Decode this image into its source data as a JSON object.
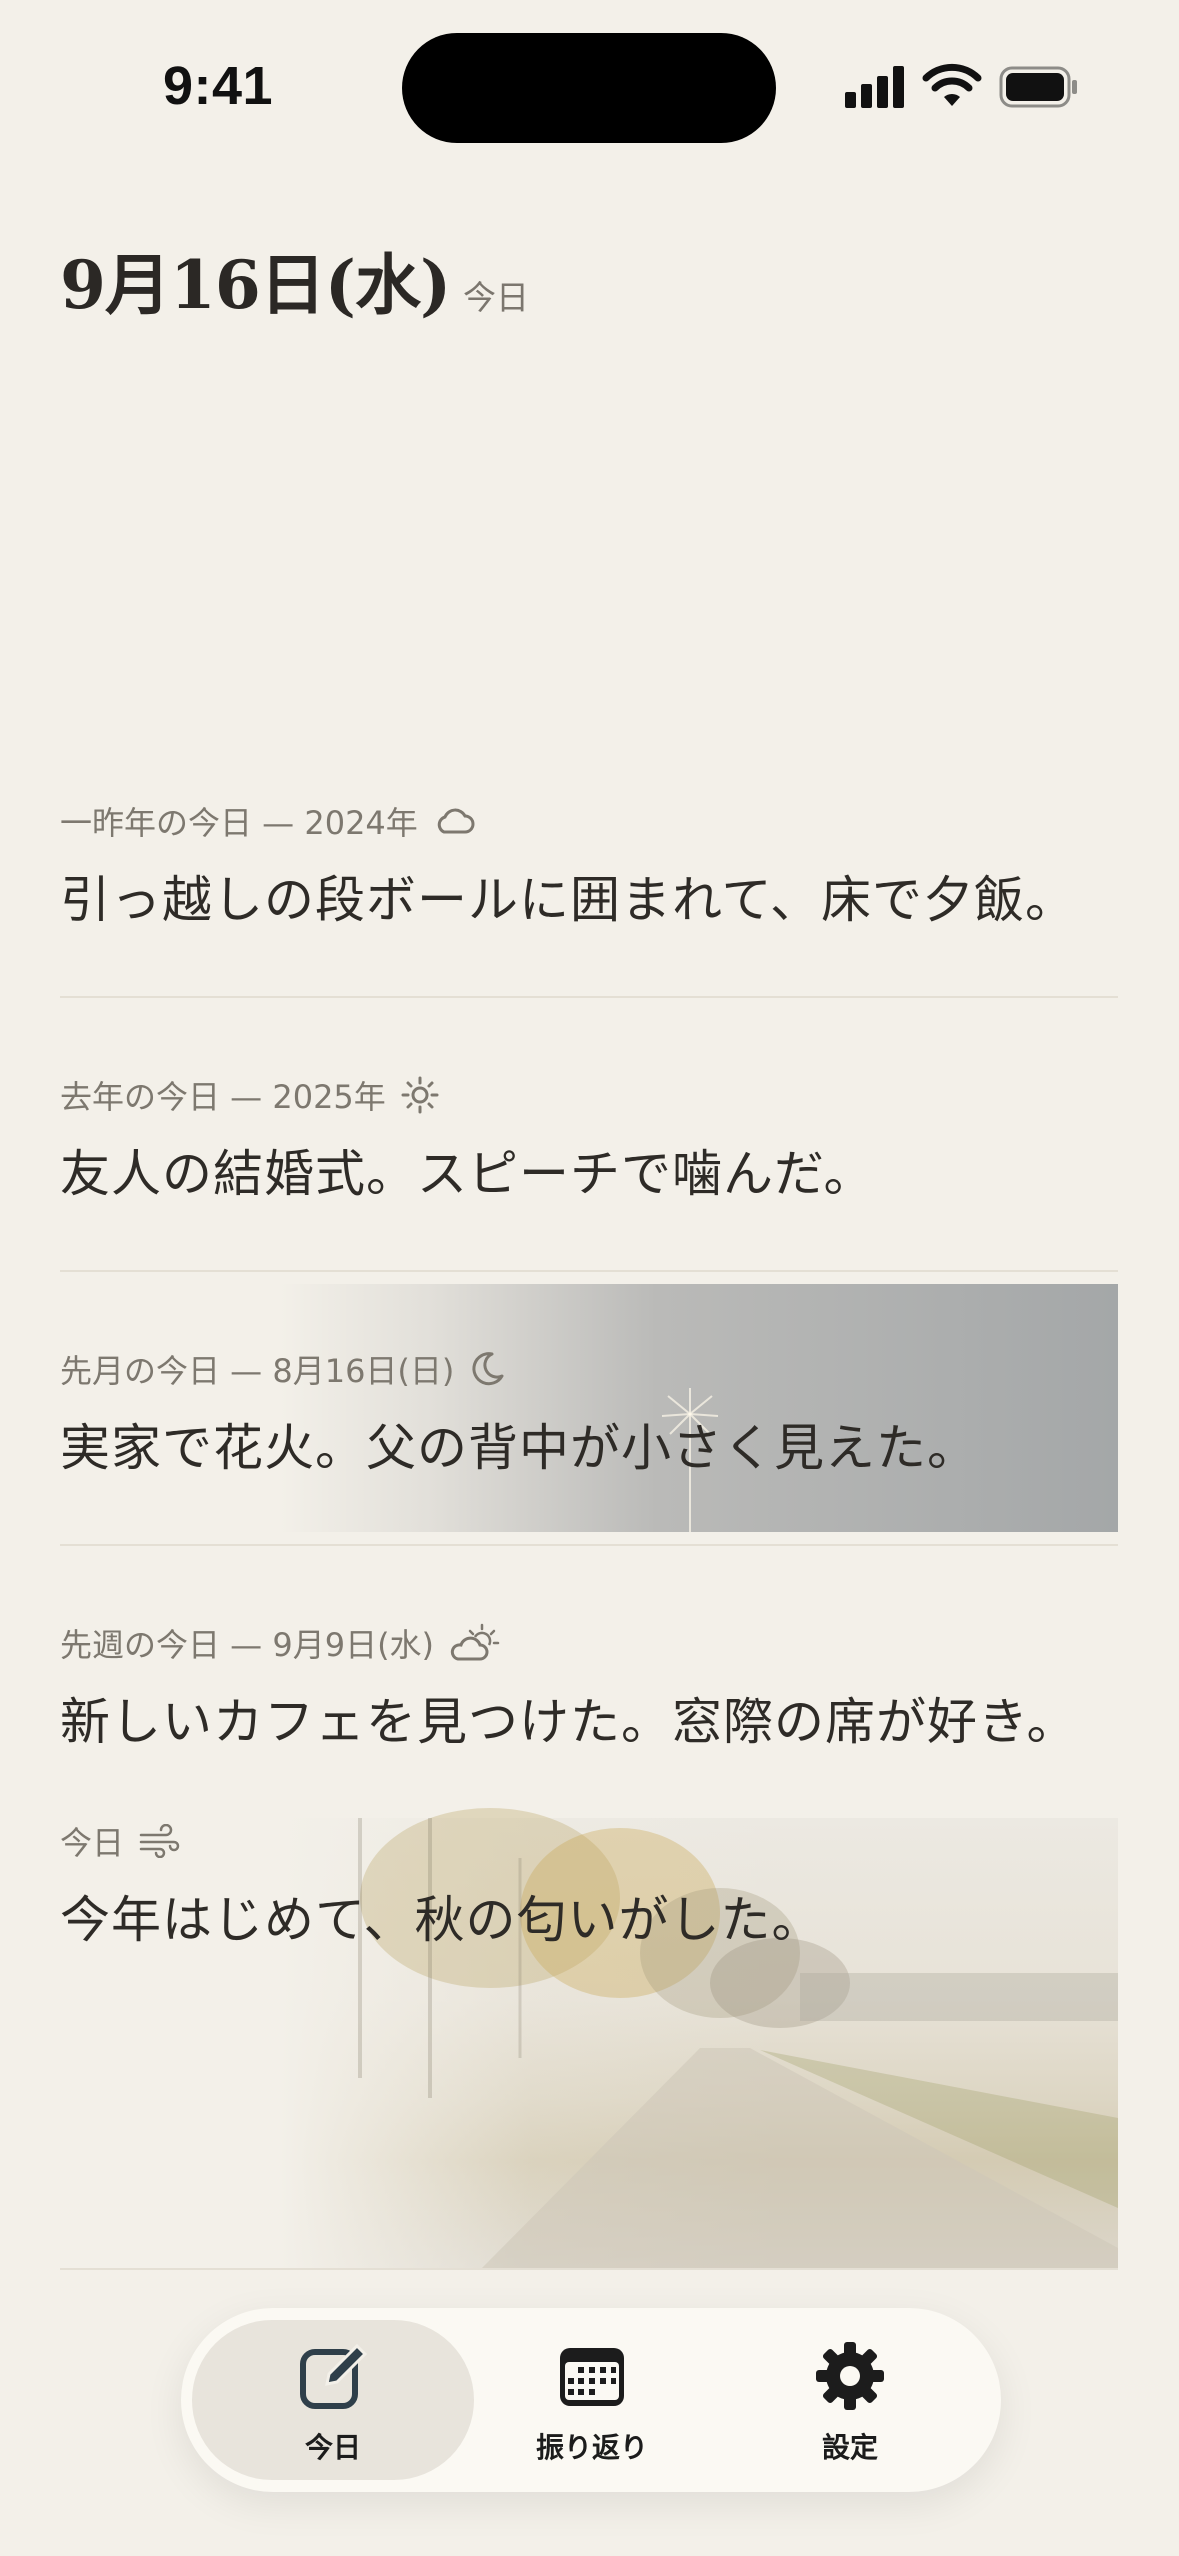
{
  "status_bar": {
    "time": "9:41"
  },
  "header": {
    "date": "9月16日(水)",
    "today_label": "今日"
  },
  "entries": [
    {
      "label": "一昨年の今日 — 2024年",
      "weather_icon": "cloud-icon",
      "text": "引っ越しの段ボールに囲まれて、床で夕飯。"
    },
    {
      "label": "去年の今日 — 2025年",
      "weather_icon": "sun-icon",
      "text": "友人の結婚式。スピーチで噛んだ。"
    },
    {
      "label": "先月の今日 — 8月16日(日)",
      "weather_icon": "moon-icon",
      "text": "実家で花火。父の背中が小さく見えた。"
    },
    {
      "label": "先週の今日 — 9月9日(水)",
      "weather_icon": "partly-cloudy-icon",
      "text": "新しいカフェを見つけた。窓際の席が好き。"
    },
    {
      "label": "今日",
      "weather_icon": "wind-icon",
      "text": "今年はじめて、秋の匂いがした。"
    }
  ],
  "tabs": [
    {
      "label": "今日",
      "icon": "compose-icon",
      "active": true
    },
    {
      "label": "振り返り",
      "icon": "calendar-icon",
      "active": false
    },
    {
      "label": "設定",
      "icon": "gear-icon",
      "active": false
    }
  ]
}
